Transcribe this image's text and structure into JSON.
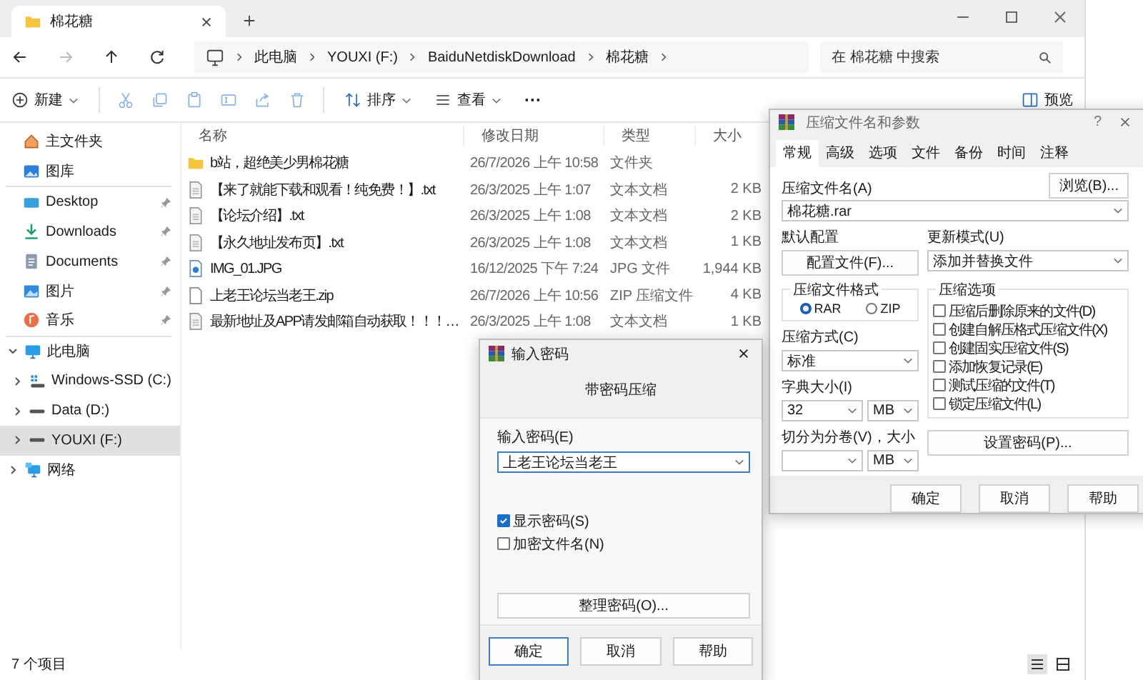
{
  "explorer": {
    "tab": {
      "title": "棉花糖"
    },
    "breadcrumb": [
      "此电脑",
      "YOUXI (F:)",
      "BaiduNetdiskDownload",
      "棉花糖"
    ],
    "search": {
      "placeholder": "在 棉花糖 中搜索"
    },
    "toolbar": {
      "new": "新建",
      "sort": "排序",
      "view": "查看",
      "more": "···",
      "preview": "预览"
    },
    "sidebar": {
      "top": [
        {
          "kind": "home",
          "label": "主文件夹"
        },
        {
          "kind": "gallery",
          "label": "图库"
        }
      ],
      "quick": [
        {
          "kind": "desktop",
          "label": "Desktop",
          "pinned": true
        },
        {
          "kind": "downloads",
          "label": "Downloads",
          "pinned": true
        },
        {
          "kind": "documents",
          "label": "Documents",
          "pinned": true
        },
        {
          "kind": "pictures",
          "label": "图片",
          "pinned": true
        },
        {
          "kind": "music",
          "label": "音乐",
          "pinned": true
        }
      ],
      "tree": [
        {
          "kind": "pc",
          "label": "此电脑",
          "expanded": true,
          "selected": false,
          "children": [
            {
              "kind": "os-drive",
              "label": "Windows-SSD (C:)",
              "expanded": false,
              "selected": false
            },
            {
              "kind": "drive",
              "label": "Data (D:)",
              "expanded": false,
              "selected": false
            },
            {
              "kind": "drive",
              "label": "YOUXI (F:)",
              "expanded": false,
              "selected": true
            }
          ]
        },
        {
          "kind": "network",
          "label": "网络",
          "expanded": false,
          "selected": false
        }
      ]
    },
    "columns": [
      "名称",
      "修改日期",
      "类型",
      "大小"
    ],
    "files": [
      {
        "kind": "folder",
        "name": "b站，超绝美少男棉花糖",
        "date": "26/7/2026 上午 10:58",
        "type": "文件夹"
      },
      {
        "kind": "text",
        "name": "【来了就能下载和观看！纯免费！】.txt",
        "date": "26/3/2025 上午 1:07",
        "type": "文本文档",
        "size": "2 KB"
      },
      {
        "kind": "text",
        "name": "【论坛介绍】.txt",
        "date": "26/3/2025 上午 1:08",
        "type": "文本文档",
        "size": "2 KB"
      },
      {
        "kind": "text",
        "name": "【永久地址发布页】.txt",
        "date": "26/3/2025 上午 1:08",
        "type": "文本文档",
        "size": "1 KB"
      },
      {
        "kind": "image",
        "name": "IMG_01.JPG",
        "date": "16/12/2025 下午 7:24",
        "type": "JPG 文件",
        "size": "1,944 KB"
      },
      {
        "kind": "zip",
        "name": "上老王论坛当老王.zip",
        "date": "26/7/2026 上午 10:56",
        "type": "ZIP 压缩文件",
        "size": "4 KB"
      },
      {
        "kind": "text",
        "name": "最新地址及APP请发邮箱自动获取！！！…",
        "date": "26/3/2025 上午 1:08",
        "type": "文本文档",
        "size": "1 KB"
      }
    ],
    "status": "7 个项目",
    "view_buttons": [
      {
        "kind": "details",
        "selected": true
      },
      {
        "kind": "tiles",
        "selected": false
      }
    ]
  },
  "archive_dialog": {
    "title": "压缩文件名和参数",
    "help": "?",
    "tabs": [
      {
        "label": "常规",
        "selected": true
      },
      {
        "label": "高级",
        "selected": false
      },
      {
        "label": "选项",
        "selected": false
      },
      {
        "label": "文件",
        "selected": false
      },
      {
        "label": "备份",
        "selected": false
      },
      {
        "label": "时间",
        "selected": false
      },
      {
        "label": "注释",
        "selected": false
      }
    ],
    "archive_name": {
      "label": "压缩文件名(A)",
      "value": "棉花糖.rar"
    },
    "browse": "浏览(B)...",
    "profile": {
      "label": "默认配置",
      "button": "配置文件(F)..."
    },
    "update_mode": {
      "label": "更新模式(U)",
      "value": "添加并替换文件"
    },
    "format": {
      "label": "压缩文件格式",
      "options": [
        {
          "label": "RAR",
          "selected": true
        },
        {
          "label": "ZIP",
          "selected": false
        }
      ]
    },
    "method": {
      "label": "压缩方式(C)",
      "value": "标准"
    },
    "dictionary": {
      "label": "字典大小(I)",
      "value": "32",
      "unit": "MB"
    },
    "split": {
      "label": "切分为分卷(V)，大小",
      "unit": "MB"
    },
    "options": {
      "label": "压缩选项",
      "items": [
        {
          "label": "压缩后删除原来的文件(D)",
          "checked": false
        },
        {
          "label": "创建自解压格式压缩文件(X)",
          "checked": false
        },
        {
          "label": "创建固实压缩文件(S)",
          "checked": false
        },
        {
          "label": "添加恢复记录(E)",
          "checked": false
        },
        {
          "label": "测试压缩的文件(T)",
          "checked": false
        },
        {
          "label": "锁定压缩文件(L)",
          "checked": false
        }
      ]
    },
    "set_password": "设置密码(P)...",
    "buttons": [
      "确定",
      "取消",
      "帮助"
    ]
  },
  "password_dialog": {
    "title": "输入密码",
    "heading": "带密码压缩",
    "password": {
      "label": "输入密码(E)",
      "value": "上老王论坛当老王"
    },
    "checks": [
      {
        "label": "显示密码(S)",
        "checked": true
      },
      {
        "label": "加密文件名(N)",
        "checked": false
      }
    ],
    "organize": "整理密码(O)...",
    "buttons": [
      {
        "label": "确定",
        "default": true
      },
      {
        "label": "取消",
        "default": false
      },
      {
        "label": "帮助",
        "default": false
      }
    ]
  }
}
